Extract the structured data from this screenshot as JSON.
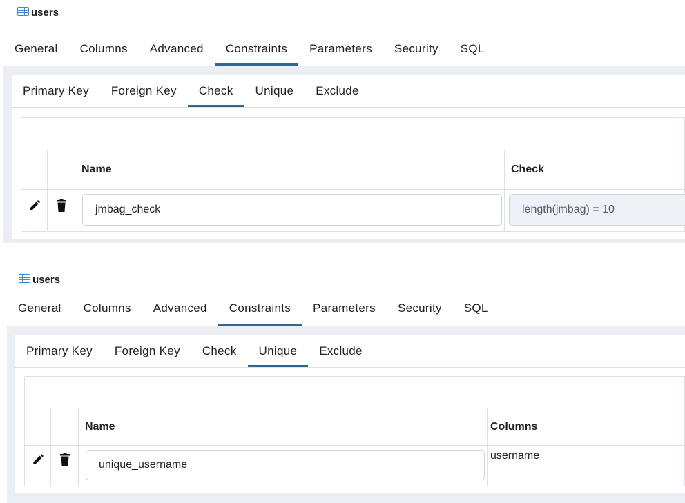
{
  "panels": [
    {
      "title": "users",
      "main_tabs": [
        "General",
        "Columns",
        "Advanced",
        "Constraints",
        "Parameters",
        "Security",
        "SQL"
      ],
      "active_main_tab": "Constraints",
      "sub_tabs": [
        "Primary Key",
        "Foreign Key",
        "Check",
        "Unique",
        "Exclude"
      ],
      "active_sub_tab": "Check",
      "grid": {
        "columns": [
          "Name",
          "Check"
        ],
        "rows": [
          {
            "name": "jmbag_check",
            "value": "length(jmbag) = 10"
          }
        ]
      }
    },
    {
      "title": "users",
      "main_tabs": [
        "General",
        "Columns",
        "Advanced",
        "Constraints",
        "Parameters",
        "Security",
        "SQL"
      ],
      "active_main_tab": "Constraints",
      "sub_tabs": [
        "Primary Key",
        "Foreign Key",
        "Check",
        "Unique",
        "Exclude"
      ],
      "active_sub_tab": "Unique",
      "grid": {
        "columns": [
          "Name",
          "Columns"
        ],
        "rows": [
          {
            "name": "unique_username",
            "value": "username"
          }
        ]
      }
    }
  ],
  "icons": {
    "table": "table-icon",
    "edit": "edit-icon",
    "delete": "delete-icon"
  },
  "colors": {
    "accent": "#326690",
    "table_icon": "#3f86d6",
    "content_bg": "#ebeef3",
    "border": "#dde0e6"
  }
}
